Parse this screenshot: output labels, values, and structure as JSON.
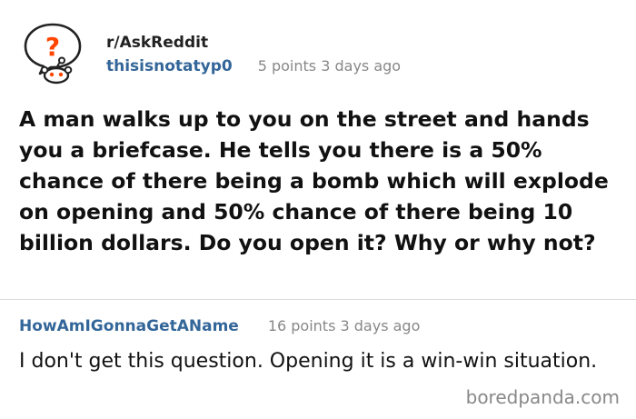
{
  "post": {
    "avatar_icon": "reddit-askreddit-snoo-icon",
    "subreddit": "r/AskReddit",
    "username": "thisisnotatyp0",
    "meta": "5 points 3 days ago",
    "title": "A man walks up to you on the street and hands you a briefcase. He tells you there is a 50% chance of there being a bomb which will explode on opening and 50% chance of there being 10 billion dollars. Do you open it? Why or why not?"
  },
  "comment": {
    "username": "HowAmIGonnaGetAName",
    "meta": "16 points 3 days ago",
    "body": "I don't get this question. Opening it is a win-win situation."
  },
  "watermark": "boredpanda.com",
  "colors": {
    "username": "#336699",
    "meta": "#888888",
    "text": "#111111",
    "divider": "#dcdcdc",
    "avatar_accent": "#ff4500"
  }
}
